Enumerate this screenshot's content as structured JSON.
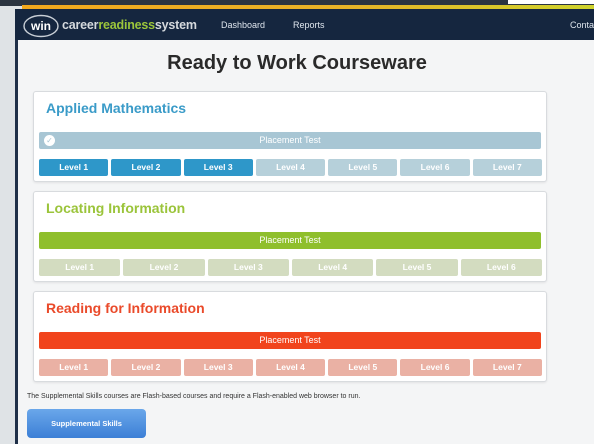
{
  "header": {
    "logo_text": "win",
    "brand_part1": "career",
    "brand_part2": "readiness",
    "brand_part3": "system",
    "nav": [
      "Dashboard",
      "Reports",
      "Contac"
    ]
  },
  "page_title": "Ready to Work Courseware",
  "courses": [
    {
      "title": "Applied Mathematics",
      "title_color": "#3a9bc8",
      "placement_label": "Placement Test",
      "placement_completed": true,
      "placement_color": "#a8c6d4",
      "active_color": "#2e97c9",
      "inactive_color": "#b6d0da",
      "levels": [
        {
          "label": "Level 1",
          "active": true
        },
        {
          "label": "Level 2",
          "active": true
        },
        {
          "label": "Level 3",
          "active": true
        },
        {
          "label": "Level 4",
          "active": false
        },
        {
          "label": "Level 5",
          "active": false
        },
        {
          "label": "Level 6",
          "active": false
        },
        {
          "label": "Level 7",
          "active": false
        }
      ]
    },
    {
      "title": "Locating Information",
      "title_color": "#9bc43a",
      "placement_label": "Placement Test",
      "placement_completed": false,
      "placement_color": "#8fbf2c",
      "active_color": "#8fbf2c",
      "inactive_color": "#d3dcc0",
      "levels": [
        {
          "label": "Level 1",
          "active": false
        },
        {
          "label": "Level 2",
          "active": false
        },
        {
          "label": "Level 3",
          "active": false
        },
        {
          "label": "Level 4",
          "active": false
        },
        {
          "label": "Level 5",
          "active": false
        },
        {
          "label": "Level 6",
          "active": false
        }
      ]
    },
    {
      "title": "Reading for Information",
      "title_color": "#ea4a2a",
      "placement_label": "Placement Test",
      "placement_completed": false,
      "placement_color": "#f1441c",
      "active_color": "#f1441c",
      "inactive_color": "#eab1a4",
      "levels": [
        {
          "label": "Level 1",
          "active": false
        },
        {
          "label": "Level 2",
          "active": false
        },
        {
          "label": "Level 3",
          "active": false
        },
        {
          "label": "Level 4",
          "active": false
        },
        {
          "label": "Level 5",
          "active": false
        },
        {
          "label": "Level 6",
          "active": false
        },
        {
          "label": "Level 7",
          "active": false
        }
      ]
    }
  ],
  "supplemental_note": "The Supplemental Skills courses are Flash-based courses and require a Flash-enabled web browser to run.",
  "supplemental_button": "Supplemental Skills"
}
